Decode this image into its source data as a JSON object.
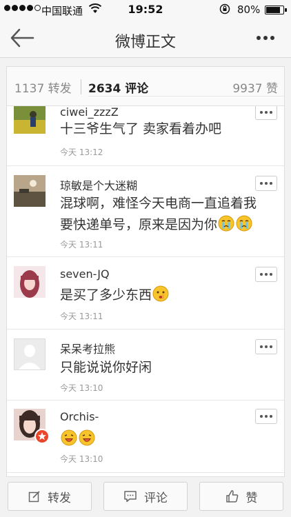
{
  "status_bar": {
    "carrier": "中国联通",
    "time": "19:52",
    "battery": "80%"
  },
  "nav": {
    "title": "微博正文"
  },
  "tabs": {
    "reposts": "1137 转发",
    "comments": "2634 评论",
    "likes": "9937 赞"
  },
  "comments": [
    {
      "user": "ciwei_zzzZ",
      "text": "十三爷生气了 卖家看着办吧",
      "time": "今天 13:12"
    },
    {
      "user": "琼敏是个大迷糊",
      "text_line1": "混球啊，难怪今天电商一直追着我",
      "text_line2": "要快递单号，原来是因为你",
      "time": "今天 13:11"
    },
    {
      "user": "seven-JQ",
      "text": "是买了多少东西",
      "time": "今天 13:11"
    },
    {
      "user": "呆呆考拉熊",
      "text": "只能说说你好闲",
      "time": "今天 13:10"
    },
    {
      "user": "Orchis-",
      "text": "",
      "time": "今天 13:10"
    }
  ],
  "toolbar": {
    "repost": "转发",
    "comment": "评论",
    "like": "赞"
  },
  "colors": {
    "badge": "#e8472c",
    "emoji_yellow": "#f7c52b"
  }
}
